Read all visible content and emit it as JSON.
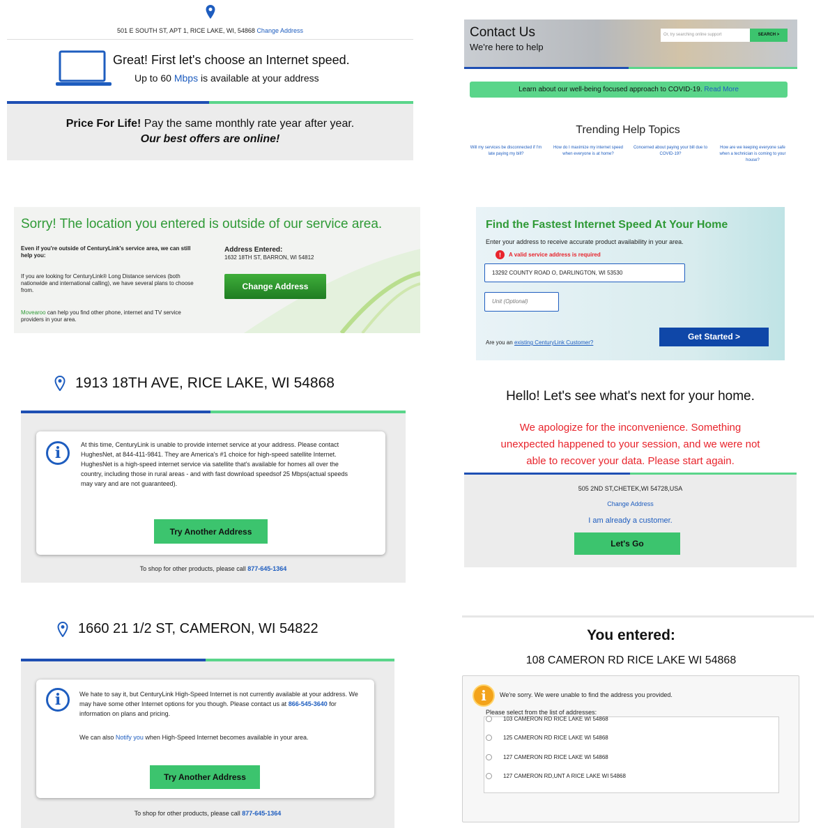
{
  "p1": {
    "address": "501 E SOUTH ST, APT 1, RICE LAKE, WI, 54868",
    "change_link": "Change Address",
    "headline": "Great! First let's choose an Internet speed.",
    "sub_prefix": "Up to 60",
    "sub_unit": "Mbps",
    "sub_suffix": "is available at your address",
    "pfl_bold": "Price For Life!",
    "pfl_rest": "Pay the same monthly rate year after year.",
    "pfl_italic": "Our best offers are online!"
  },
  "p2": {
    "title": "Contact Us",
    "subtitle": "We're here to help",
    "search_placeholder": "Or, try searching online support",
    "search_button": "SEARCH >",
    "covid_text": "Learn about our well-being focused approach to COVID-19.",
    "covid_link": "Read More",
    "trending_title": "Trending Help Topics",
    "topics": [
      "Will my services be disconnected if I'm late paying my bill?",
      "How do I maximize my internet speed when everyone is at home?",
      "Concerned about paying your bill due to COVID-19?",
      "How are we keeping everyone safe when a technician is coming to your house?"
    ]
  },
  "p3": {
    "headline": "Sorry! The location you entered is outside of our service area.",
    "help_bold": "Even if you're outside of CenturyLink's service area, we can still help you:",
    "long_distance": "If you are looking for CenturyLink® Long Distance services (both nationwide and international calling), we have several plans to choose from.",
    "movearoo_link": "Movearoo",
    "movearoo_rest": "can help you find other phone, internet and TV service providers in your area.",
    "addr_label": "Address Entered:",
    "addr_value": "1632 18TH ST, BARRON, WI 54812",
    "change_button": "Change Address"
  },
  "p4": {
    "title": "Find the Fastest Internet Speed At Your Home",
    "intro": "Enter your address to receive accurate product availability in your area.",
    "error": "A valid service address is required",
    "address_value": "13292 COUNTY ROAD O, DARLINGTON, WI 53530",
    "unit_placeholder": "Unit (Optional)",
    "existing_prefix": "Are you an",
    "existing_link": "existing CenturyLink Customer?",
    "get_started": "Get Started >"
  },
  "p5": {
    "address": "1913 18TH AVE, RICE LAKE, WI 54868",
    "message": "At this time, CenturyLink is unable to provide internet service at your address. Please contact HughesNet, at 844-411-9841. They are America's #1 choice for high-speed satellite Internet. HughesNet is a high-speed internet service via satellite that's available for homes all over the country, including those in rural areas - and with fast download speedsof 25 Mbps(actual speeds may vary and are not guaranteed).",
    "try_button": "Try Another Address",
    "shop_prefix": "To shop for other products, please call",
    "shop_phone": "877-645-1364"
  },
  "p6": {
    "hello": "Hello! Let's see what's next for your home.",
    "apology": "We apologize for the inconvenience. Something unexpected happened to your session, and we were not able to recover your data. Please start again.",
    "address": "505 2ND ST,CHETEK,WI 54728,USA",
    "change_link": "Change Address",
    "customer_link": "I am already a customer.",
    "lets_go": "Let's Go"
  },
  "p7": {
    "address": "1660 21 1/2 ST, CAMERON, WI 54822",
    "msg1_a": "We hate to say it, but CenturyLink High-Speed Internet is not currently available at your address. We may have some other Internet options for you though. Please contact us at",
    "msg1_phone": "866-545-3640",
    "msg1_b": "for information on plans and pricing.",
    "msg2_a": "We can also",
    "msg2_link": "Notify you",
    "msg2_b": "when High-Speed Internet becomes available in your area.",
    "try_button": "Try Another Address",
    "shop_prefix": "To shop for other products, please call",
    "shop_phone": "877-645-1364"
  },
  "p8": {
    "title": "You entered:",
    "entered": "108 CAMERON RD RICE LAKE WI 54868",
    "sorry": "We're sorry. We were unable to find the address you provided.",
    "select_label": "Please select from the list of addresses:",
    "options": [
      "103 CAMERON RD RICE LAKE WI 54868",
      "125 CAMERON RD RICE LAKE WI 54868",
      "127 CAMERON RD RICE LAKE WI 54868",
      "127 CAMERON RD,UNT A RICE LAKE WI 54868"
    ]
  },
  "colors": {
    "brand_blue": "#1e4fb3",
    "brand_green": "#3cc46e",
    "link_blue": "#1e5dbf",
    "error_red": "#e8242c",
    "navy_button": "#0f47a8"
  }
}
